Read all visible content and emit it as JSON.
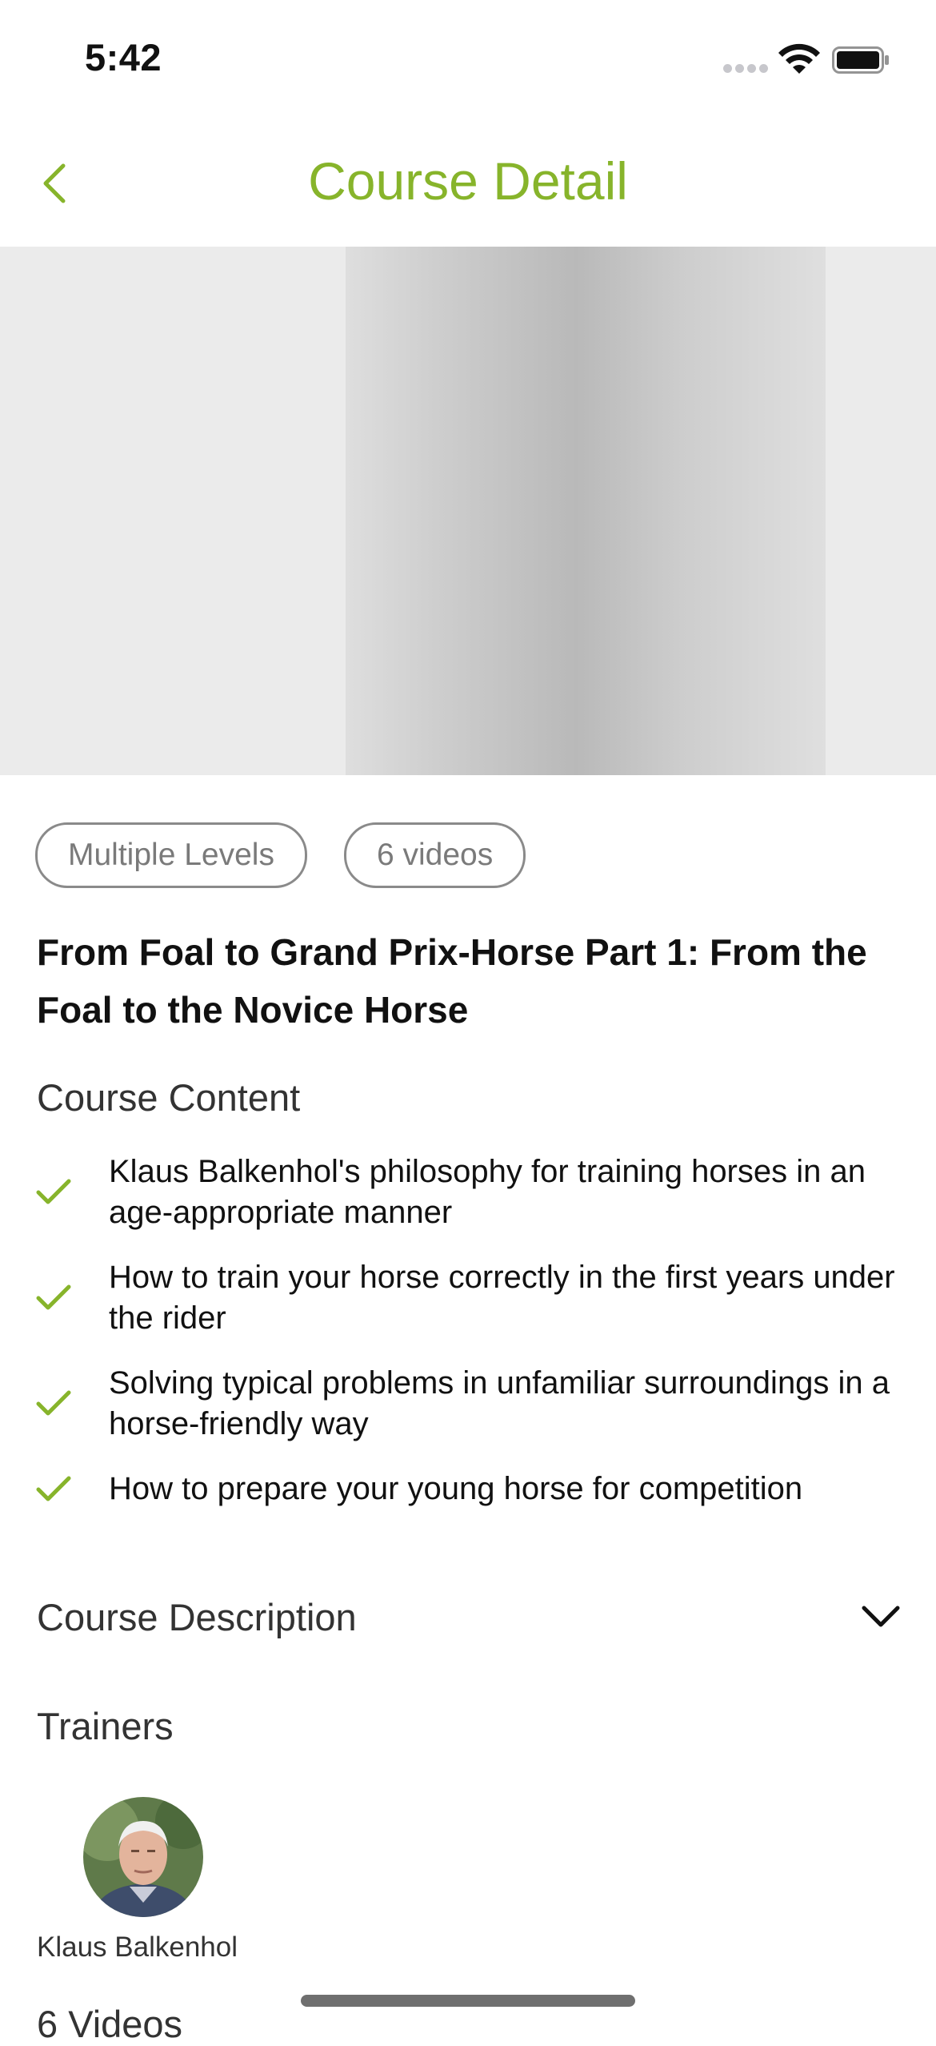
{
  "status_bar": {
    "time": "5:42"
  },
  "nav": {
    "title": "Course Detail",
    "accent_color": "#87b42b",
    "back_icon": "chevron-left-icon"
  },
  "tags": [
    "Multiple Levels",
    "6 videos"
  ],
  "course": {
    "title": "From Foal to Grand Prix-Horse Part 1: From the Foal to the Novice Horse",
    "content_label": "Course Content",
    "content_items": [
      "Klaus Balkenhol's philosophy for training horses in an age-appropriate manner",
      "How to train your horse correctly in the first years under the rider",
      "Solving typical problems in unfamiliar surroundings in a horse-friendly way",
      "How to prepare your young horse for competition"
    ],
    "description_label": "Course Description",
    "trainers_label": "Trainers",
    "trainers": [
      {
        "name": "Klaus Balkenhol"
      }
    ],
    "videos_label": "6 Videos"
  }
}
